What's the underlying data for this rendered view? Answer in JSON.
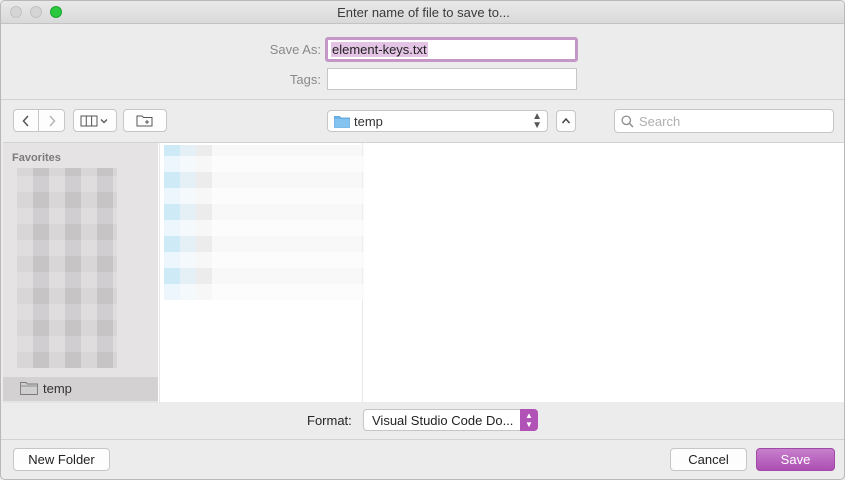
{
  "window": {
    "title": "Enter name of file to save to..."
  },
  "form": {
    "save_as_label": "Save As:",
    "save_as_value": "element-keys.txt",
    "tags_label": "Tags:",
    "tags_value": ""
  },
  "toolbar": {
    "location": "temp",
    "search_placeholder": "Search"
  },
  "sidebar": {
    "heading": "Favorites",
    "selected_item": "temp"
  },
  "bottom": {
    "format_label": "Format:",
    "format_value": "Visual Studio Code Do...",
    "new_folder_label": "New Folder",
    "cancel_label": "Cancel",
    "save_label": "Save"
  },
  "colors": {
    "accent": "#b152b6",
    "maximize": "#2bc940",
    "folder": "#6cb5e9"
  }
}
